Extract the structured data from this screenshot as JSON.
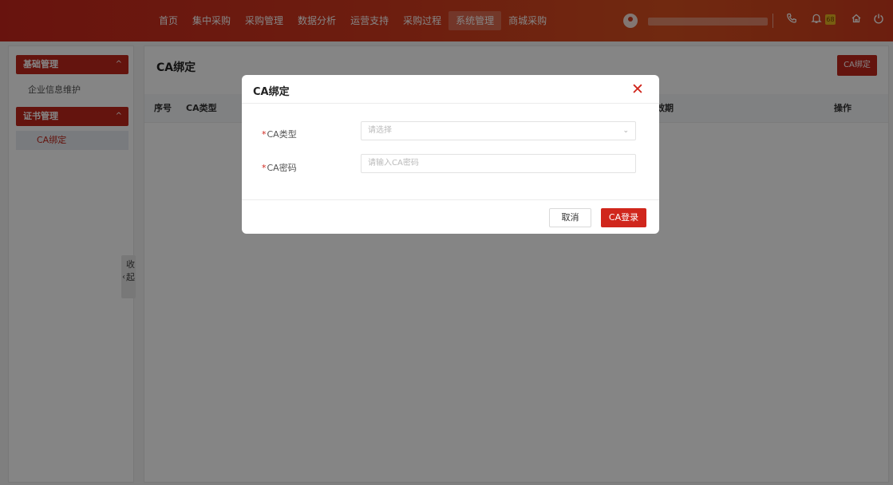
{
  "nav": {
    "items": [
      "首页",
      "集中采购",
      "采购管理",
      "数据分析",
      "运营支持",
      "采购过程",
      "系统管理",
      "商城采购"
    ],
    "active_index": 6
  },
  "header": {
    "badge": "68",
    "icons": [
      "user-avatar-icon",
      "phone-icon",
      "bell-icon",
      "home-icon",
      "logout-icon"
    ]
  },
  "sidebar": {
    "groups": [
      {
        "label": "基础管理",
        "items": [
          "企业信息维护"
        ]
      },
      {
        "label": "证书管理",
        "items": [
          "CA绑定"
        ]
      }
    ],
    "collapse_label": "收起"
  },
  "page": {
    "title": "CA绑定",
    "action_button": "CA绑定",
    "table_headers": [
      "序号",
      "CA类型",
      "效期",
      "操作"
    ]
  },
  "modal": {
    "title": "CA绑定",
    "fields": [
      {
        "label": "CA类型",
        "required": true,
        "placeholder": "请选择",
        "type": "select"
      },
      {
        "label": "CA密码",
        "required": true,
        "placeholder": "请输入CA密码",
        "type": "input"
      }
    ],
    "cancel_label": "取消",
    "submit_label": "CA登录"
  },
  "colors": {
    "brand": "#c0281c",
    "accent": "#d0261c"
  }
}
